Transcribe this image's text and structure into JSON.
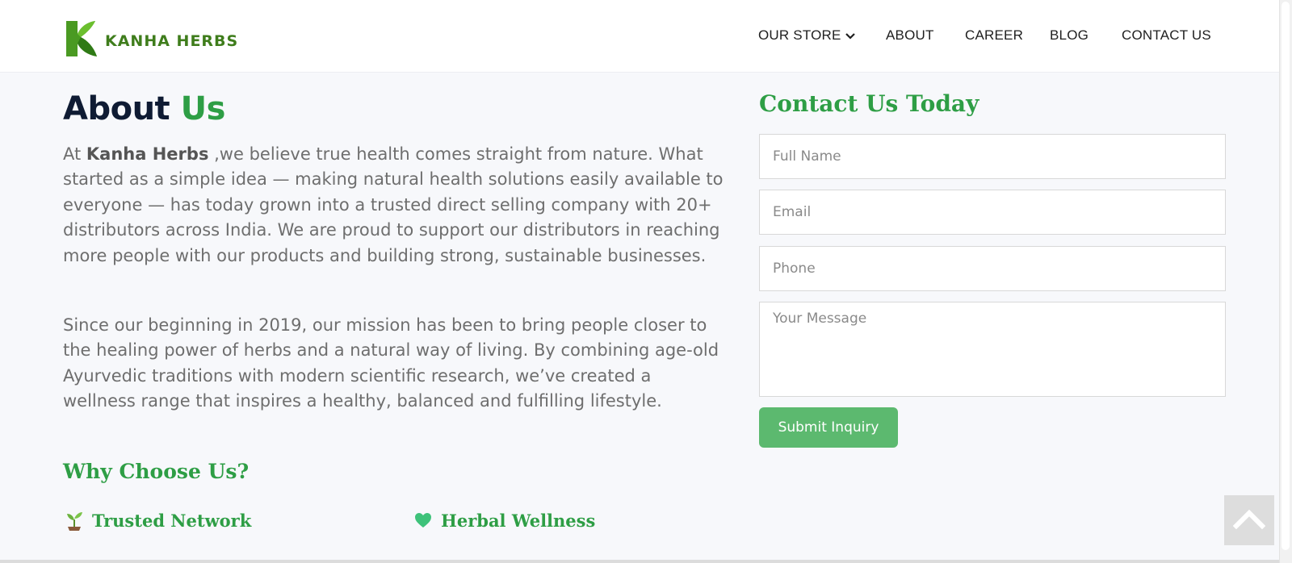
{
  "header": {
    "logo_text": "KANHA HERBS",
    "nav": [
      {
        "label": "OUR STORE",
        "has_dropdown": true
      },
      {
        "label": "ABOUT"
      },
      {
        "label": "CAREER"
      },
      {
        "label": "BLOG"
      },
      {
        "label": "CONTACT US"
      }
    ]
  },
  "about": {
    "title_main": "About",
    "title_accent": "Us",
    "p1_prefix": "At ",
    "p1_brand": "Kanha Herbs",
    "p1_rest": " ,we believe true health comes straight from nature. What started as a simple idea — making natural health solutions easily available to everyone — has today grown into a trusted direct selling company with 20+ distributors across India. We are proud to support our distributors in reaching more people with our products and building strong, sustainable businesses.",
    "p2": "Since our beginning in 2019, our mission has been to bring people closer to the healing power of herbs and a natural way of living. By combining age-old Ayurvedic traditions with modern scientific research, we’ve created a wellness range that inspires a healthy, balanced and fulfilling lifestyle.",
    "why_title": "Why Choose Us?",
    "features": [
      {
        "label": "Trusted Network",
        "icon": "seedling-icon"
      },
      {
        "label": "Herbal Wellness",
        "icon": "green-heart-icon"
      }
    ]
  },
  "contact": {
    "title": "Contact Us Today",
    "fields": {
      "name_placeholder": "Full Name",
      "email_placeholder": "Email",
      "phone_placeholder": "Phone",
      "message_placeholder": "Your Message"
    },
    "submit_label": "Submit Inquiry"
  },
  "colors": {
    "brand_green": "#2e9e45",
    "button_green": "#5cb96f",
    "logo_green": "#3f7d1c",
    "heading_navy": "#0f1b33"
  },
  "scroll_to_top": {
    "icon": "chevron-up-icon"
  }
}
